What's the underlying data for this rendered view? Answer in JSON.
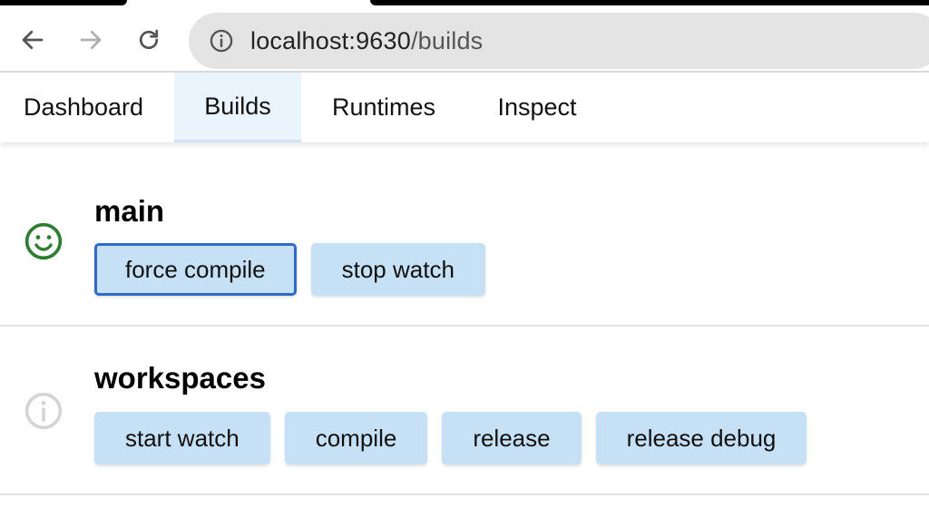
{
  "browser": {
    "url_host": "localhost:9630",
    "url_path": "/builds"
  },
  "tabs": [
    {
      "label": "Dashboard"
    },
    {
      "label": "Builds"
    },
    {
      "label": "Runtimes"
    },
    {
      "label": "Inspect"
    }
  ],
  "active_tab": "Builds",
  "builds": [
    {
      "name": "main",
      "status": "ok",
      "status_color": "#2e7d32",
      "actions": [
        {
          "label": "force compile"
        },
        {
          "label": "stop watch"
        }
      ]
    },
    {
      "name": "workspaces",
      "status": "info",
      "status_color": "#d4d4d4",
      "actions": [
        {
          "label": "start watch"
        },
        {
          "label": "compile"
        },
        {
          "label": "release"
        },
        {
          "label": "release debug"
        }
      ]
    }
  ],
  "colors": {
    "action_bg": "#c6e0f5",
    "focus_border": "#2f6ac8",
    "active_tab_bg": "#eaf4fd"
  },
  "icons": {
    "back": "arrow-left-icon",
    "forward": "arrow-right-icon",
    "reload": "reload-icon",
    "site_info": "info-circle-icon",
    "build_ok": "smiley-icon",
    "build_info": "info-circle-icon"
  }
}
